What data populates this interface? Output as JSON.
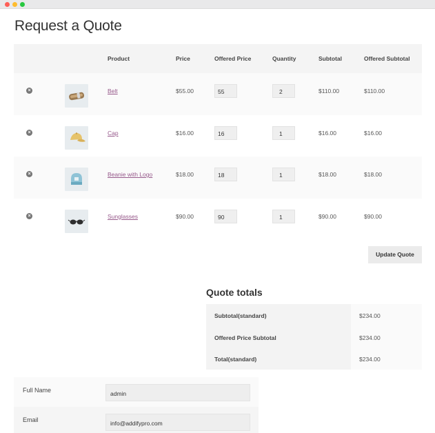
{
  "window": {
    "controls": [
      "close",
      "minimize",
      "maximize"
    ]
  },
  "page": {
    "title": "Request a Quote"
  },
  "table": {
    "headers": {
      "remove": "",
      "thumbnail": "",
      "product": "Product",
      "price": "Price",
      "offered_price": "Offered Price",
      "quantity": "Quantity",
      "subtotal": "Subtotal",
      "offered_subtotal": "Offered Subtotal"
    },
    "rows": [
      {
        "product": "Belt",
        "price": "$55.00",
        "offered_price": "55",
        "quantity": "2",
        "subtotal": "$110.00",
        "offered_subtotal": "$110.00",
        "thumb_icon": "belt-icon"
      },
      {
        "product": "Cap",
        "price": "$16.00",
        "offered_price": "16",
        "quantity": "1",
        "subtotal": "$16.00",
        "offered_subtotal": "$16.00",
        "thumb_icon": "cap-icon"
      },
      {
        "product": "Beanie with Logo",
        "price": "$18.00",
        "offered_price": "18",
        "quantity": "1",
        "subtotal": "$18.00",
        "offered_subtotal": "$18.00",
        "thumb_icon": "beanie-icon"
      },
      {
        "product": "Sunglasses",
        "price": "$90.00",
        "offered_price": "90",
        "quantity": "1",
        "subtotal": "$90.00",
        "offered_subtotal": "$90.00",
        "thumb_icon": "sunglasses-icon"
      }
    ],
    "remove_icon": "close-circle-icon"
  },
  "actions": {
    "update_label": "Update Quote"
  },
  "totals": {
    "title": "Quote totals",
    "rows": [
      {
        "label": "Subtotal(standard)",
        "value": "$234.00"
      },
      {
        "label": "Offered Price Subtotal",
        "value": "$234.00"
      },
      {
        "label": "Total(standard)",
        "value": "$234.00"
      }
    ]
  },
  "form": {
    "fields": [
      {
        "label": "Full Name",
        "value": "admin"
      },
      {
        "label": "Email",
        "value": "info@addifypro.com"
      }
    ]
  },
  "colors": {
    "link": "#96588a",
    "header_bg": "#f4f4f4",
    "button_bg": "#ebebeb"
  }
}
